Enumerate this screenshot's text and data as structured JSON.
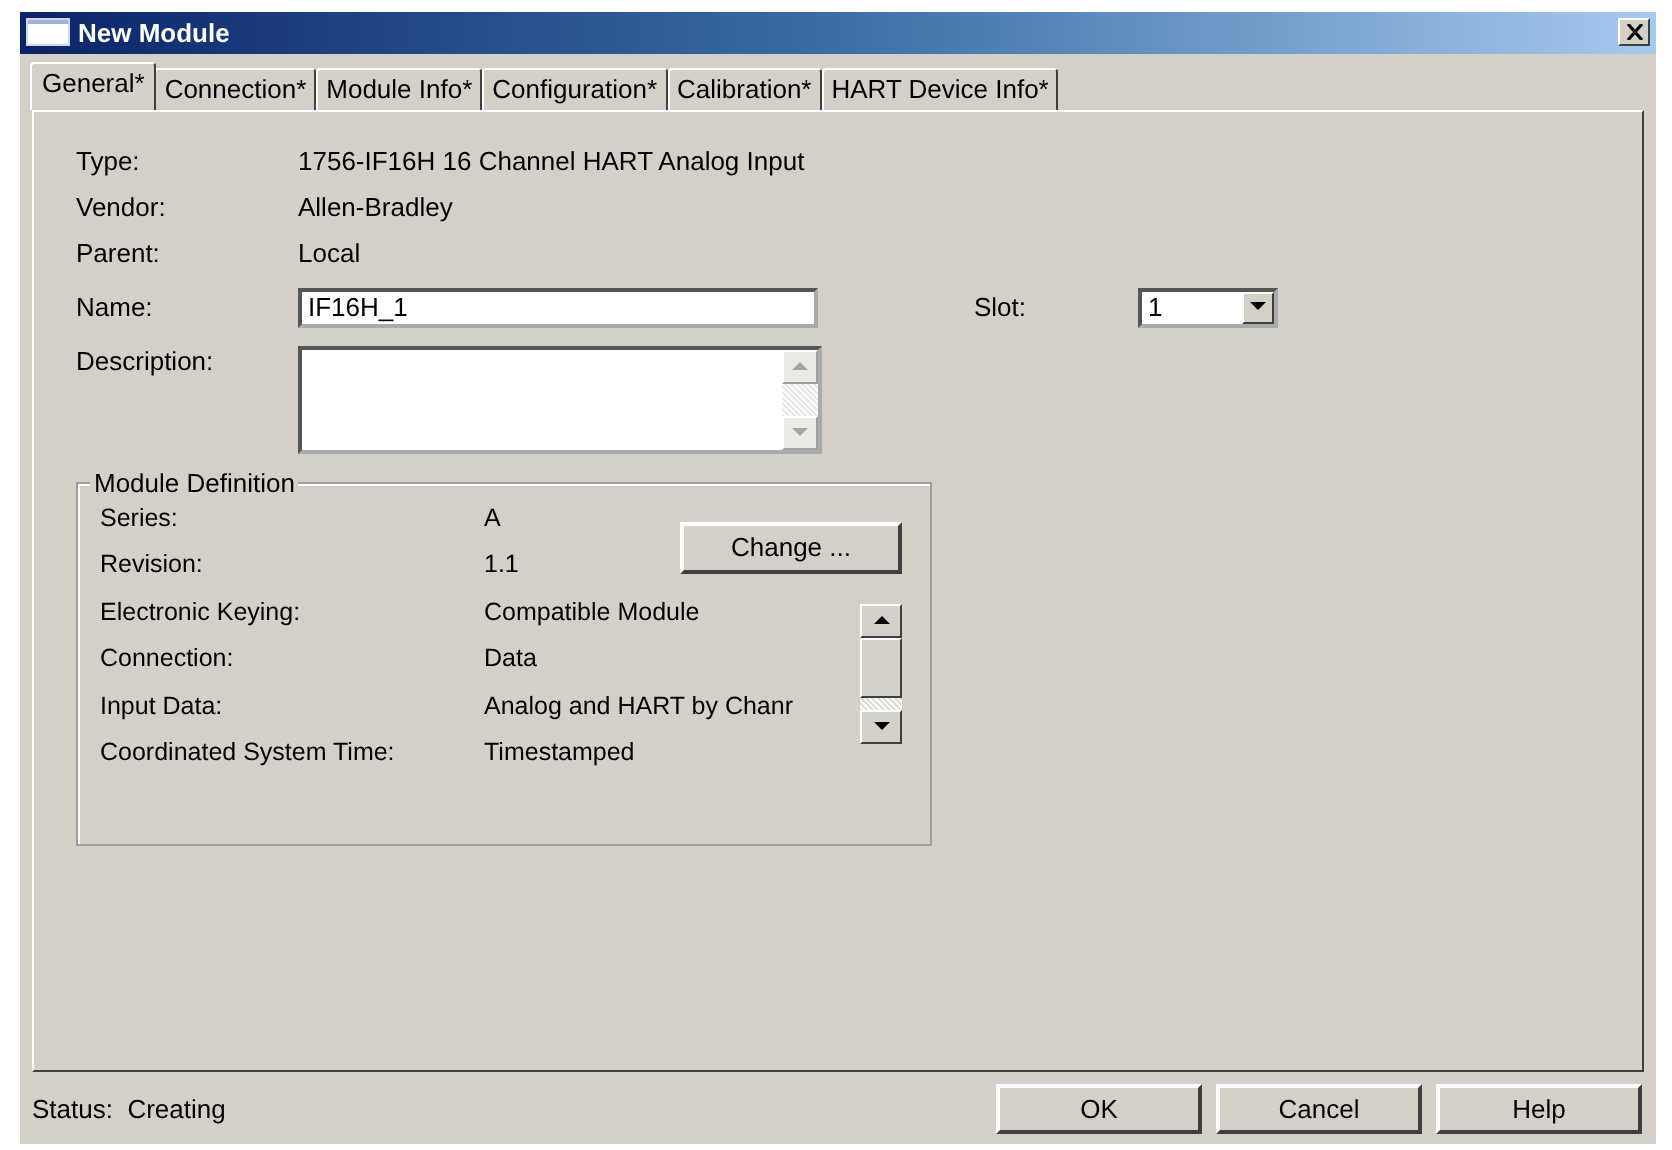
{
  "window": {
    "title": "New Module"
  },
  "tabs": [
    {
      "label": "General*",
      "selected": true
    },
    {
      "label": "Connection*",
      "selected": false
    },
    {
      "label": "Module Info*",
      "selected": false
    },
    {
      "label": "Configuration*",
      "selected": false
    },
    {
      "label": "Calibration*",
      "selected": false
    },
    {
      "label": "HART Device Info*",
      "selected": false
    }
  ],
  "info": [
    {
      "label": "Type:",
      "value": "1756-IF16H 16 Channel HART Analog Input"
    },
    {
      "label": "Vendor:",
      "value": "Allen-Bradley"
    },
    {
      "label": "Parent:",
      "value": "Local"
    }
  ],
  "name": {
    "label": "Name:",
    "value": "IF16H_1"
  },
  "slot": {
    "label": "Slot:",
    "value": "1"
  },
  "description": {
    "label": "Description:"
  },
  "module_definition": {
    "title": "Module Definition",
    "change_button": "Change ...",
    "rows": [
      {
        "label": "Series:",
        "value": "A"
      },
      {
        "label": "Revision:",
        "value": "1.1"
      },
      {
        "label": "Electronic Keying:",
        "value": "Compatible Module"
      },
      {
        "label": "Connection:",
        "value": "Data"
      },
      {
        "label": "Input Data:",
        "value": "Analog and HART by Chanr"
      },
      {
        "label": "Coordinated System Time:",
        "value": "Timestamped"
      }
    ]
  },
  "status": {
    "label": "Status:",
    "value": "Creating"
  },
  "buttons": [
    "OK",
    "Cancel",
    "Help"
  ]
}
